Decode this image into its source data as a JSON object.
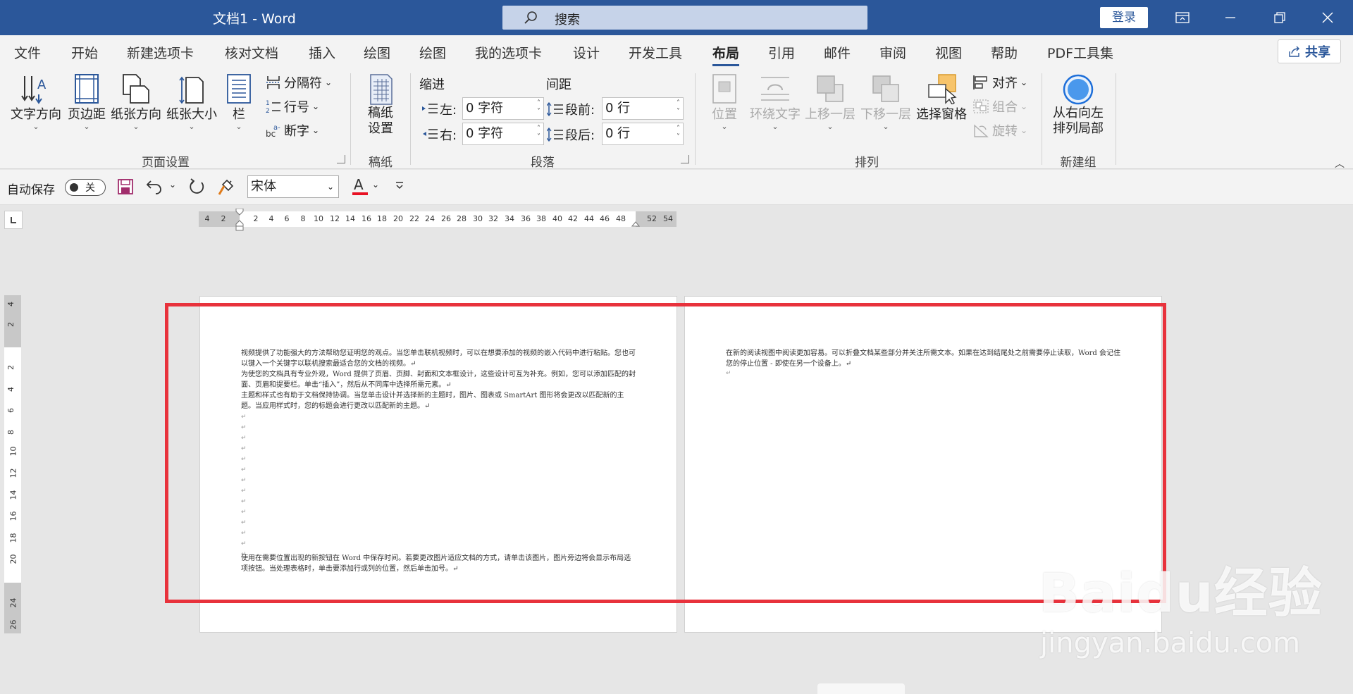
{
  "titlebar": {
    "doc_title": "文档1  -  Word",
    "search_placeholder": "搜索",
    "login": "登录"
  },
  "tabs": [
    "文件",
    "开始",
    "新建选项卡",
    "核对文档",
    "插入",
    "绘图",
    "绘图",
    "我的选项卡",
    "设计",
    "开发工具",
    "布局",
    "引用",
    "邮件",
    "审阅",
    "视图",
    "帮助",
    "PDF工具集"
  ],
  "active_tab": "布局",
  "share": "共享",
  "ribbon": {
    "page_setup": {
      "text_direction": "文字方向",
      "margins": "页边距",
      "orientation": "纸张方向",
      "size": "纸张大小",
      "columns": "栏",
      "breaks": "分隔符",
      "line_numbers": "行号",
      "hyphenation": "断字",
      "label": "页面设置"
    },
    "manuscript": {
      "setup": "稿纸\n设置",
      "setup_line1": "稿纸",
      "setup_line2": "设置",
      "label": "稿纸"
    },
    "paragraph": {
      "indent_title": "缩进",
      "spacing_title": "间距",
      "left_label": "左:",
      "right_label": "右:",
      "before_label": "段前:",
      "after_label": "段后:",
      "left_value": "0 字符",
      "right_value": "0 字符",
      "before_value": "0 行",
      "after_value": "0 行",
      "label": "段落"
    },
    "arrange": {
      "position": "位置",
      "wrap_text": "环绕文字",
      "bring_forward": "上移一层",
      "send_backward": "下移一层",
      "selection_pane": "选择窗格",
      "align": "对齐",
      "group": "组合",
      "rotate": "旋转",
      "label": "排列"
    },
    "new_group": {
      "rtl_line1": "从右向左",
      "rtl_line2": "排列局部",
      "label": "新建组"
    }
  },
  "qat": {
    "autosave_label": "自动保存",
    "autosave_state": "关",
    "font_name": "宋体"
  },
  "ruler": {
    "h_ticks": [
      "4",
      "2",
      "2",
      "4",
      "6",
      "8",
      "10",
      "12",
      "14",
      "16",
      "18",
      "20",
      "22",
      "24",
      "26",
      "28",
      "30",
      "32",
      "34",
      "36",
      "38",
      "40",
      "42",
      "44",
      "46",
      "48",
      "52",
      "54"
    ],
    "v_ticks": [
      "4",
      "2",
      "2",
      "4",
      "6",
      "8",
      "10",
      "12",
      "14",
      "16",
      "18",
      "20",
      "24",
      "26"
    ]
  },
  "page1": {
    "para1": "视频提供了功能强大的方法帮助您证明您的观点。当您单击联机视频时，可以在想要添加的视频的嵌入代码中进行粘贴。您也可以键入一个关键字以联机搜索最适合您的文档的视频。↵",
    "para2": "为使您的文档具有专业外观，Word 提供了页眉、页脚、封面和文本框设计，这些设计可互为补充。例如，您可以添加匹配的封面、页眉和提要栏。单击“插入”，然后从不同库中选择所需元素。↵",
    "para3": "主题和样式也有助于文档保持协调。当您单击设计并选择新的主题时，图片、图表或 SmartArt 图形将会更改以匹配新的主题。当应用样式时，您的标题会进行更改以匹配新的主题。↵",
    "para4": "使用在需要位置出现的新按钮在 Word 中保存时间。若要更改图片适应文档的方式，请单击该图片，图片旁边将会显示布局选项按钮。当处理表格时，单击要添加行或列的位置，然后单击加号。↵"
  },
  "page2": {
    "para1": "在新的阅读视图中阅读更加容易。可以折叠文档某些部分并关注所需文本。如果在达到结尾处之前需要停止读取，Word 会记住您的停止位置 - 即使在另一个设备上。↵"
  },
  "watermark": {
    "brand": "Baidu经验",
    "url": "jingyan.baidu.com"
  },
  "colors": {
    "accent": "#2b579a",
    "highlight_box": "#e8323c"
  }
}
